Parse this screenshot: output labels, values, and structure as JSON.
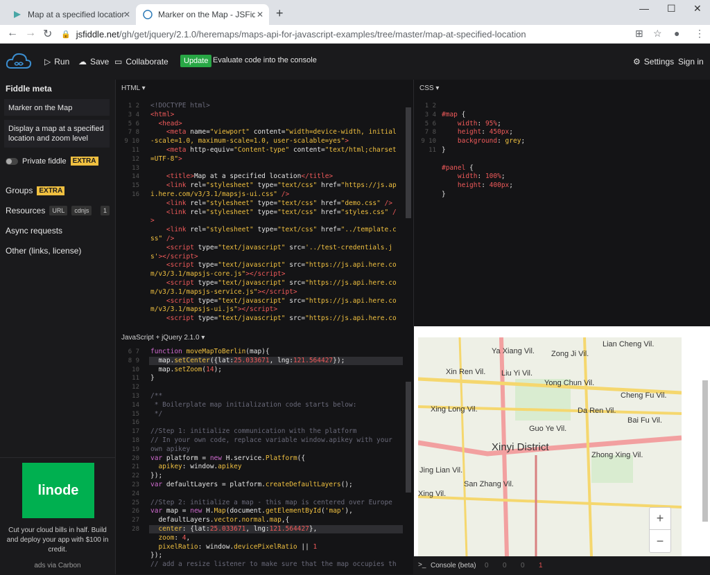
{
  "browser": {
    "tabs": [
      {
        "title": "Map at a specified location - M",
        "active": false
      },
      {
        "title": "Marker on the Map - JSFiddle - ",
        "active": true
      }
    ],
    "url_host": "jsfiddle.net",
    "url_path": "/gh/get/jquery/2.1.0/heremaps/maps-api-for-javascript-examples/tree/master/map-at-specified-location"
  },
  "toolbar": {
    "run": "Run",
    "save": "Save",
    "collaborate": "Collaborate",
    "update": "Update",
    "evaluate": "Evaluate code into the console",
    "settings": "Settings",
    "signin": "Sign in"
  },
  "sidebar": {
    "heading": "Fiddle meta",
    "title_value": "Marker on the Map",
    "description_value": "Display a map at a specified location and zoom level",
    "private": "Private fiddle",
    "extra": "EXTRA",
    "groups": "Groups",
    "resources": "Resources",
    "url_pill": "URL",
    "cdnjs_pill": "cdnjs",
    "resources_count": "1",
    "async": "Async requests",
    "other": "Other (links, license)",
    "ad_brand": "linode",
    "ad_text": "Cut your cloud bills in half. Build and deploy your app with $100 in credit.",
    "ad_via": "ads via Carbon"
  },
  "panels": {
    "html_title": "HTML",
    "css_title": "CSS",
    "js_title": "JavaScript + jQuery 2.1.0",
    "console_title": "Console (beta)",
    "console_counts": [
      "0",
      "0",
      "0",
      "1"
    ]
  },
  "map": {
    "labels": [
      "Lian Cheng Vil.",
      "Ya Xiang Vil.",
      "Zong Ji Vil.",
      "Xin Ren Vil.",
      "Liu Yi Vil.",
      "Yong Chun Vil.",
      "Cheng Fu Vil.",
      "Xing Long Vil.",
      "Da Ren Vil.",
      "Bai Fu Vil.",
      "Guo Ye Vil.",
      "Xinyi District",
      "Zhong Xing Vil.",
      "Jing Lian Vil.",
      "San Zhang Vil.",
      "Xing Vil."
    ],
    "zoom_in": "+",
    "zoom_out": "−"
  }
}
